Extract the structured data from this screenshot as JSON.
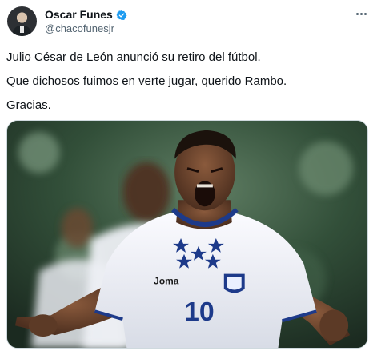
{
  "author": {
    "display_name": "Oscar Funes",
    "handle": "@chacofunesjr",
    "verified": true,
    "avatar_icon": "avatar-photo"
  },
  "menu_icon": "more-horizontal-icon",
  "tweet": {
    "paragraphs": [
      "Julio César de León anunció su retiro del fútbol.",
      "Que dichosos fuimos en verte jugar, querido Rambo.",
      "Gracias."
    ]
  },
  "media": {
    "kind": "photo",
    "jersey_brand": "Joma",
    "jersey_number": "10"
  },
  "colors": {
    "verified_badge": "#1d9bf0",
    "jersey_blue": "#1d3a8a",
    "handle_gray": "#536471"
  }
}
